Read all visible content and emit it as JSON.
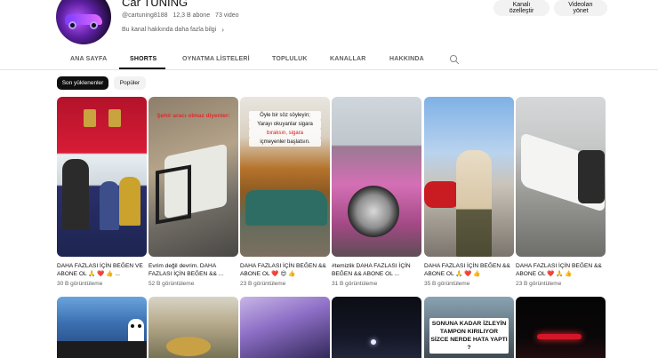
{
  "channel": {
    "name": "Car TUNING",
    "handle": "@cartuning8188",
    "subscribers": "12,3 B abone",
    "videos": "73 video",
    "more_info": "Bu kanal hakkında daha fazla bilgi",
    "customize_label": "Kanalı özelleştir",
    "manage_label": "Videoları yönet"
  },
  "tabs": [
    {
      "label": "ANA SAYFA",
      "active": false
    },
    {
      "label": "SHORTS",
      "active": true
    },
    {
      "label": "OYNATMA LİSTELERİ",
      "active": false
    },
    {
      "label": "TOPLULUK",
      "active": false
    },
    {
      "label": "KANALLAR",
      "active": false
    },
    {
      "label": "HAKKINDA",
      "active": false
    }
  ],
  "filters": {
    "recent": "Son yüklenenler",
    "popular": "Popüler"
  },
  "shorts_row1": [
    {
      "title": "DAHA FAZLASI İÇİN BEĞEN VE ABONE OL 🙏 ❤️ 👍 ...",
      "views": "30 B görüntüleme"
    },
    {
      "title": "Evrim değil devrim. DAHA FAZLASI İÇİN BEĞEN && ...",
      "views": "52 B görüntüleme",
      "overlay": "Şehir aracı olmaz diyenler:"
    },
    {
      "title": "DAHA FAZLASI İÇİN BEĞEN && ABONE OL ❤️ 😍 👍",
      "views": "23 B görüntüleme",
      "caption_lines": [
        "Öyle bir söz söyleyin;",
        "Yarayı okuyanlar sigara",
        "bıraksın, sigara",
        "içmeyenler başlatsın."
      ]
    },
    {
      "title": "#temizlik DAHA FAZLASI İÇİN BEĞEN && ABONE OL ...",
      "views": "31 B görüntüleme"
    },
    {
      "title": "DAHA FAZLASI İÇİN BEĞEN && ABONE OL 🙏 ❤️ 👍",
      "views": "35 B görüntüleme"
    },
    {
      "title": "DAHA FAZLASI İÇİN BEĞEN && ABONE OL ❤️ 🙏 👍",
      "views": "23 B görüntüleme"
    }
  ],
  "shorts_row2": [
    {
      "sign": ""
    },
    {
      "sign": ""
    },
    {
      "sign": ""
    },
    {
      "sign": ""
    },
    {
      "sign": "SONUNA KADAR İZLEYİN TAMPON KIRILIYOR SİZCE NERDE HATA YAPTI ?"
    },
    {
      "sign": ""
    }
  ],
  "icons": {
    "search": "search-icon",
    "more": "chevron-right-icon"
  }
}
